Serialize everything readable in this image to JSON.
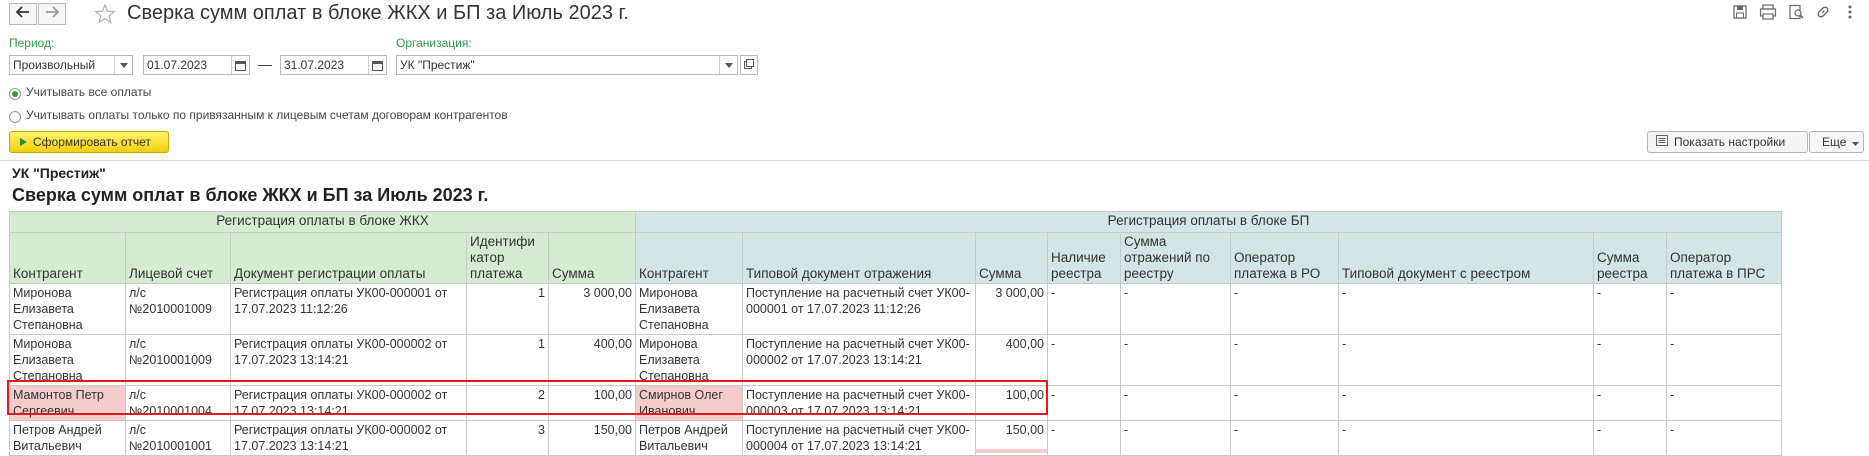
{
  "header": {
    "title": "Сверка сумм оплат в блоке ЖКХ и БП за Июль 2023 г.",
    "icons": [
      "back-arrow-icon",
      "forward-arrow-icon",
      "star-icon",
      "save-icon",
      "print-icon",
      "preview-icon",
      "link-icon",
      "more-vertical-icon"
    ]
  },
  "filters": {
    "period_label": "Период:",
    "period_value": "Произвольный",
    "date_from": "01.07.2023",
    "date_sep": "—",
    "date_to": "31.07.2023",
    "org_label": "Организация:",
    "org_value": "УК \"Престиж\""
  },
  "options": {
    "all_payments": "Учитывать все оплаты",
    "linked_payments": "Учитывать оплаты только по привязанным к лицевым счетам договорам контрагентов"
  },
  "toolbar": {
    "generate_label": "Сформировать отчет",
    "show_settings_label": "Показать настройки",
    "more_label": "Еще"
  },
  "report": {
    "org": "УК \"Престиж\"",
    "title": "Сверка сумм оплат в блоке ЖКХ и БП за Июль 2023 г.",
    "group_gkh": "Регистрация оплаты в блоке ЖКХ",
    "group_bp": "Регистрация оплаты в блоке БП",
    "columns": [
      "Контрагент",
      "Лицевой счет",
      "Документ регистрации оплаты",
      "Идентификатор платежа",
      "Сумма",
      "Контрагент",
      "Типовой документ отражения",
      "Сумма",
      "Наличие реестра",
      "Сумма отражений по реестру",
      "Оператор платежа в РО",
      "Типовой документ с реестром",
      "Сумма реестра",
      "Оператор платежа в ПРС"
    ],
    "columns_display": [
      "Контрагент",
      "Лицевой счет",
      "Документ регистрации оплаты",
      "Идентифи катор платежа",
      "Сумма",
      "Контрагент",
      "Типовой документ отражения",
      "Сумма",
      "Наличие реестра",
      "Сумма отражений по реестру",
      "Оператор платежа в РО",
      "Типовой документ с реестром",
      "Сумма реестра",
      "Оператор платежа в ПРС"
    ],
    "rows": [
      {
        "c0": "Миронова Елизавета Степановна",
        "c1": "л/с №2010001009",
        "c2": "Регистрация оплаты УК00-000001 от 17.07.2023 11:12:26",
        "c3": "1",
        "c4": "3 000,00",
        "c5": "Миронова Елизавета Степановна",
        "c6": "Поступление на расчетный счет УК00-000001 от 17.07.2023 11:12:26",
        "c7": "3 000,00",
        "c8": "-",
        "c9": "-",
        "c10": "-",
        "c11": "-",
        "c12": "-",
        "c13": "-"
      },
      {
        "c0": "Миронова Елизавета Степановна",
        "c1": "л/с №2010001009",
        "c2": "Регистрация оплаты УК00-000002 от 17.07.2023 13:14:21",
        "c3": "1",
        "c4": "400,00",
        "c5": "Миронова Елизавета Степановна",
        "c6": "Поступление на расчетный счет УК00-000002 от 17.07.2023 13:14:21",
        "c7": "400,00",
        "c8": "-",
        "c9": "-",
        "c10": "-",
        "c11": "-",
        "c12": "-",
        "c13": "-"
      },
      {
        "c0": "Мамонтов Петр Сергеевич",
        "c1": "л/с №2010001004",
        "c2": "Регистрация оплаты УК00-000002 от 17.07.2023 13:14:21",
        "c3": "2",
        "c4": "100,00",
        "c5": "Смирнов Олег Иванович",
        "c6": "Поступление на расчетный счет УК00-000003 от 17.07.2023 13:14:21",
        "c7": "100,00",
        "c8": "-",
        "c9": "-",
        "c10": "-",
        "c11": "-",
        "c12": "-",
        "c13": "-"
      },
      {
        "c0": "Петров Андрей Витальевич",
        "c1": "л/с №2010001001",
        "c2": "Регистрация оплаты УК00-000002 от 17.07.2023 13:14:21",
        "c3": "3",
        "c4": "150,00",
        "c5": "Петров Андрей Витальевич",
        "c6": "Поступление на расчетный счет УК00-000004 от 17.07.2023 13:14:21",
        "c7": "150,00",
        "c8": "-",
        "c9": "-",
        "c10": "-",
        "c11": "-",
        "c12": "-",
        "c13": "-"
      }
    ]
  },
  "colors": {
    "accent_yellow": "#f0d010",
    "gkh_header": "#d6ecd2",
    "bp_header": "#d3e5e5",
    "mismatch_highlight": "#f4cccc",
    "outline_red": "#e01b1b",
    "label_green": "#2f9b4a"
  }
}
